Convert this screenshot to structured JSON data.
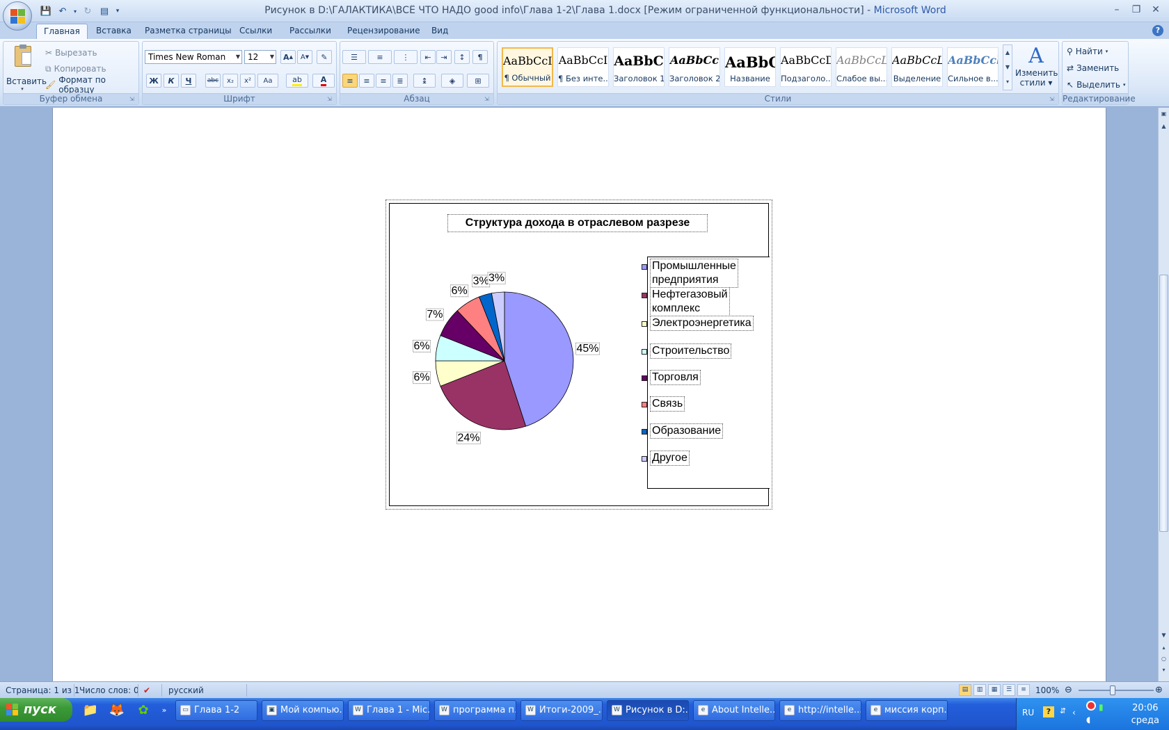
{
  "window": {
    "title_prefix": "Рисунок в D:\\ГАЛАКТИКА\\ВСЁ ЧТО НАДО good info\\Глава 1-2\\Глава 1.docx [Режим ограниченной функциональности] - ",
    "title_app": "Microsoft Word"
  },
  "tabs": [
    "Главная",
    "Вставка",
    "Разметка страницы",
    "Ссылки",
    "Рассылки",
    "Рецензирование",
    "Вид"
  ],
  "ribbon": {
    "clipboard": {
      "label": "Буфер обмена",
      "paste": "Вставить",
      "cut": "Вырезать",
      "copy": "Копировать",
      "format_painter": "Формат по образцу"
    },
    "font": {
      "label": "Шрифт",
      "font_name": "Times New Roman",
      "font_size": "12",
      "bold": "Ж",
      "italic": "К",
      "underline": "Ч",
      "strike": "abc",
      "sub": "x₂",
      "sup": "x²",
      "case": "Aa",
      "grow": "A",
      "shrink": "A"
    },
    "paragraph": {
      "label": "Абзац"
    },
    "styles": {
      "label": "Стили",
      "items": [
        {
          "sample": "AaBbCcI",
          "name": "¶ Обычный"
        },
        {
          "sample": "AaBbCcI",
          "name": "¶ Без инте..."
        },
        {
          "sample": "AaBbC",
          "name": "Заголовок 1"
        },
        {
          "sample": "AaBbCc",
          "name": "Заголовок 2"
        },
        {
          "sample": "AaBbC",
          "name": "Название"
        },
        {
          "sample": "AaBbCcD",
          "name": "Подзаголо..."
        },
        {
          "sample": "AaBbCcL",
          "name": "Слабое вы..."
        },
        {
          "sample": "AaBbCcL",
          "name": "Выделение"
        },
        {
          "sample": "AaBbCcl",
          "name": "Сильное в..."
        }
      ],
      "change_line1": "Изменить",
      "change_line2": "стили"
    },
    "editing": {
      "label": "Редактирование",
      "find": "Найти",
      "replace": "Заменить",
      "select": "Выделить"
    }
  },
  "chart_data": {
    "type": "pie",
    "title": "Структура дохода  в отраслевом разрезе",
    "categories": [
      "Промышленные предприятия",
      "Нефтегазовый комплекс",
      "Электроэнергетика",
      "Строительство",
      "Торговля",
      "Связь",
      "Образование",
      "Другое"
    ],
    "values": [
      45,
      24,
      6,
      6,
      7,
      6,
      3,
      3
    ],
    "labels": [
      "45%",
      "24%",
      "6%",
      "6%",
      "7%",
      "6%",
      "3%",
      "3%"
    ],
    "legend_text": [
      "Промышленные\nпредприятия",
      "Нефтегазовый\nкомплекс",
      "Электроэнергетика",
      "Строительство",
      "Торговля",
      "Связь",
      "Образование",
      "Другое"
    ],
    "colors": [
      "#9999ff",
      "#993366",
      "#ffffcc",
      "#ccffff",
      "#660066",
      "#ff8080",
      "#0066cc",
      "#ccccff"
    ],
    "legend_position": "right"
  },
  "status": {
    "page": "Страница: 1 из 1",
    "words": "Число слов: 0",
    "language": "русский",
    "zoom": "100%"
  },
  "taskbar": {
    "start": "пуск",
    "tasks": [
      "Глава 1-2",
      "Мой компью...",
      "Глава 1 - Mic...",
      "программа п...",
      "Итоги-2009_...",
      "Рисунок в D:...",
      "About Intelle...",
      "http://intelle...",
      "миссия корп..."
    ],
    "tray_lang": "RU",
    "time": "20:06",
    "day": "среда"
  }
}
